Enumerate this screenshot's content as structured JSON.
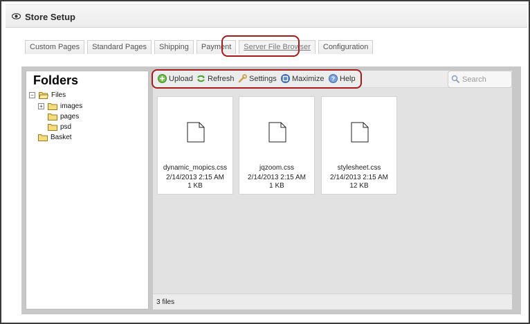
{
  "header": {
    "title": "Store Setup"
  },
  "tabs": [
    {
      "label": "Custom Pages"
    },
    {
      "label": "Standard Pages"
    },
    {
      "label": "Shipping"
    },
    {
      "label": "Payment"
    },
    {
      "label": "Server File Browser",
      "active": true
    },
    {
      "label": "Configuration"
    }
  ],
  "folders": {
    "title": "Folders",
    "tree": [
      {
        "label": "Files",
        "expander": "−"
      },
      {
        "label": "images",
        "expander": "+"
      },
      {
        "label": "pages"
      },
      {
        "label": "psd"
      },
      {
        "label": "Basket"
      }
    ]
  },
  "toolbar": {
    "upload": "Upload",
    "refresh": "Refresh",
    "settings": "Settings",
    "maximize": "Maximize",
    "help": "Help"
  },
  "search": {
    "placeholder": "Search"
  },
  "files": [
    {
      "name": "dynamic_mopics.css",
      "date": "2/14/2013 2:15 AM",
      "size": "1 KB"
    },
    {
      "name": "jqzoom.css",
      "date": "2/14/2013 2:15 AM",
      "size": "1 KB"
    },
    {
      "name": "stylesheet.css",
      "date": "2/14/2013 2:15 AM",
      "size": "12 KB"
    }
  ],
  "status": {
    "text": "3 files"
  },
  "colors": {
    "highlight": "#a51b1b",
    "panel_bg": "#c8c8c8",
    "content_bg": "#e2e2e2"
  }
}
